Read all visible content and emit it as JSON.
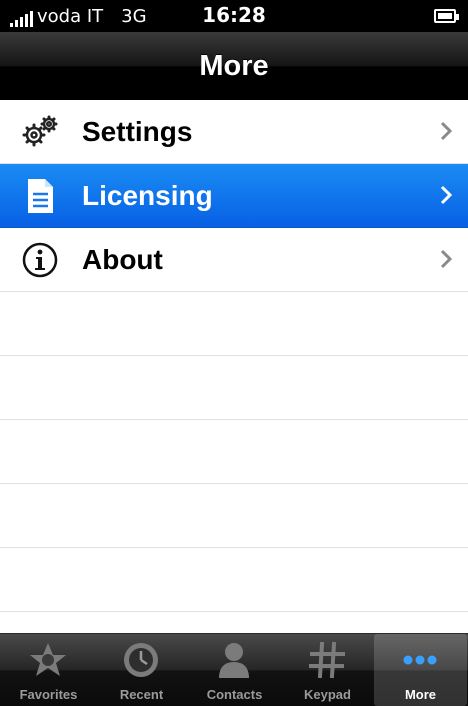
{
  "status_bar": {
    "carrier": "voda IT",
    "network": "3G",
    "time": "16:28"
  },
  "nav": {
    "title": "More"
  },
  "menu": {
    "items": [
      {
        "label": "Settings",
        "icon": "gears-icon",
        "selected": false
      },
      {
        "label": "Licensing",
        "icon": "document-icon",
        "selected": true
      },
      {
        "label": "About",
        "icon": "info-icon",
        "selected": false
      }
    ]
  },
  "tab_bar": {
    "tabs": [
      {
        "label": "Favorites",
        "icon": "star-icon",
        "active": false
      },
      {
        "label": "Recent",
        "icon": "clock-icon",
        "active": false
      },
      {
        "label": "Contacts",
        "icon": "person-icon",
        "active": false
      },
      {
        "label": "Keypad",
        "icon": "keypad-icon",
        "active": false
      },
      {
        "label": "More",
        "icon": "more-dots-icon",
        "active": true
      }
    ]
  },
  "colors": {
    "selection": "#0a6de8",
    "nav_bar": "#000000",
    "tab_bar": "#1a1a1a"
  }
}
